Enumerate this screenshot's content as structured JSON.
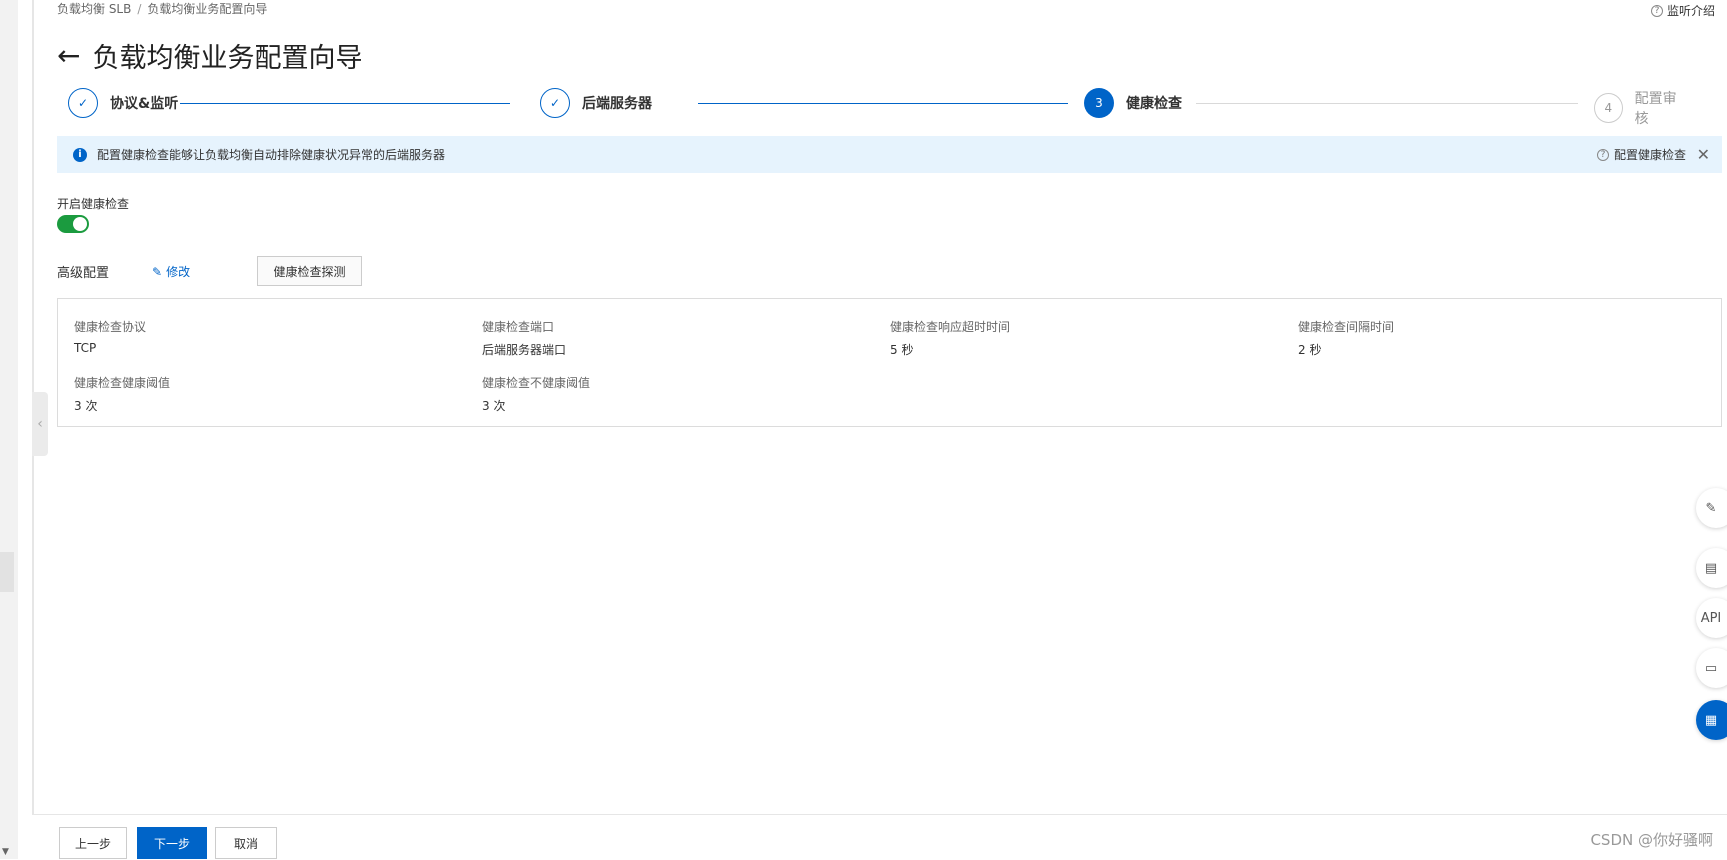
{
  "breadcrumb": [
    "负载均衡 SLB",
    "负载均衡业务配置向导"
  ],
  "breadcrumb_sep": "/",
  "top_help": "监听介绍",
  "title": "负载均衡业务配置向导",
  "back_arrow": "←",
  "steps": [
    {
      "label": "协议&监听",
      "status": "done",
      "mark": "✓"
    },
    {
      "label": "后端服务器",
      "status": "done",
      "mark": "✓"
    },
    {
      "label": "健康检查",
      "status": "active",
      "mark": "3"
    },
    {
      "label": "配置审核",
      "status": "todo",
      "mark": "4"
    }
  ],
  "info": {
    "icon": "i",
    "text": "配置健康检查能够让负载均衡自动排除健康状况异常的后端服务器",
    "link": "配置健康检查",
    "close": "✕"
  },
  "health_switch": {
    "label": "开启健康检查",
    "on": true
  },
  "advanced": {
    "label": "高级配置",
    "edit": "修改",
    "edit_icon": "✎",
    "probe": "健康检查探测"
  },
  "config": [
    {
      "label": "健康检查协议",
      "value": "TCP"
    },
    {
      "label": "健康检查端口",
      "value": "后端服务器端口"
    },
    {
      "label": "健康检查响应超时时间",
      "value": "5 秒"
    },
    {
      "label": "健康检查间隔时间",
      "value": "2 秒"
    },
    {
      "label": "健康检查健康阈值",
      "value": "3 次"
    },
    {
      "label": "健康检查不健康阈值",
      "value": "3 次"
    }
  ],
  "fabs": [
    {
      "name": "edit-icon",
      "glyph": "✎"
    },
    {
      "name": "doc-icon",
      "glyph": "▤"
    },
    {
      "name": "api-icon",
      "glyph": "API"
    },
    {
      "name": "chat-icon",
      "glyph": "▭"
    },
    {
      "name": "grid-icon",
      "glyph": "▦"
    }
  ],
  "footer": {
    "prev": "上一步",
    "next": "下一步",
    "cancel": "取消"
  },
  "watermark": "CSDN @你好骚啊",
  "colors": {
    "primary": "#0064c8",
    "success": "#1b9b3f",
    "info_bg": "#e6f3fd"
  }
}
